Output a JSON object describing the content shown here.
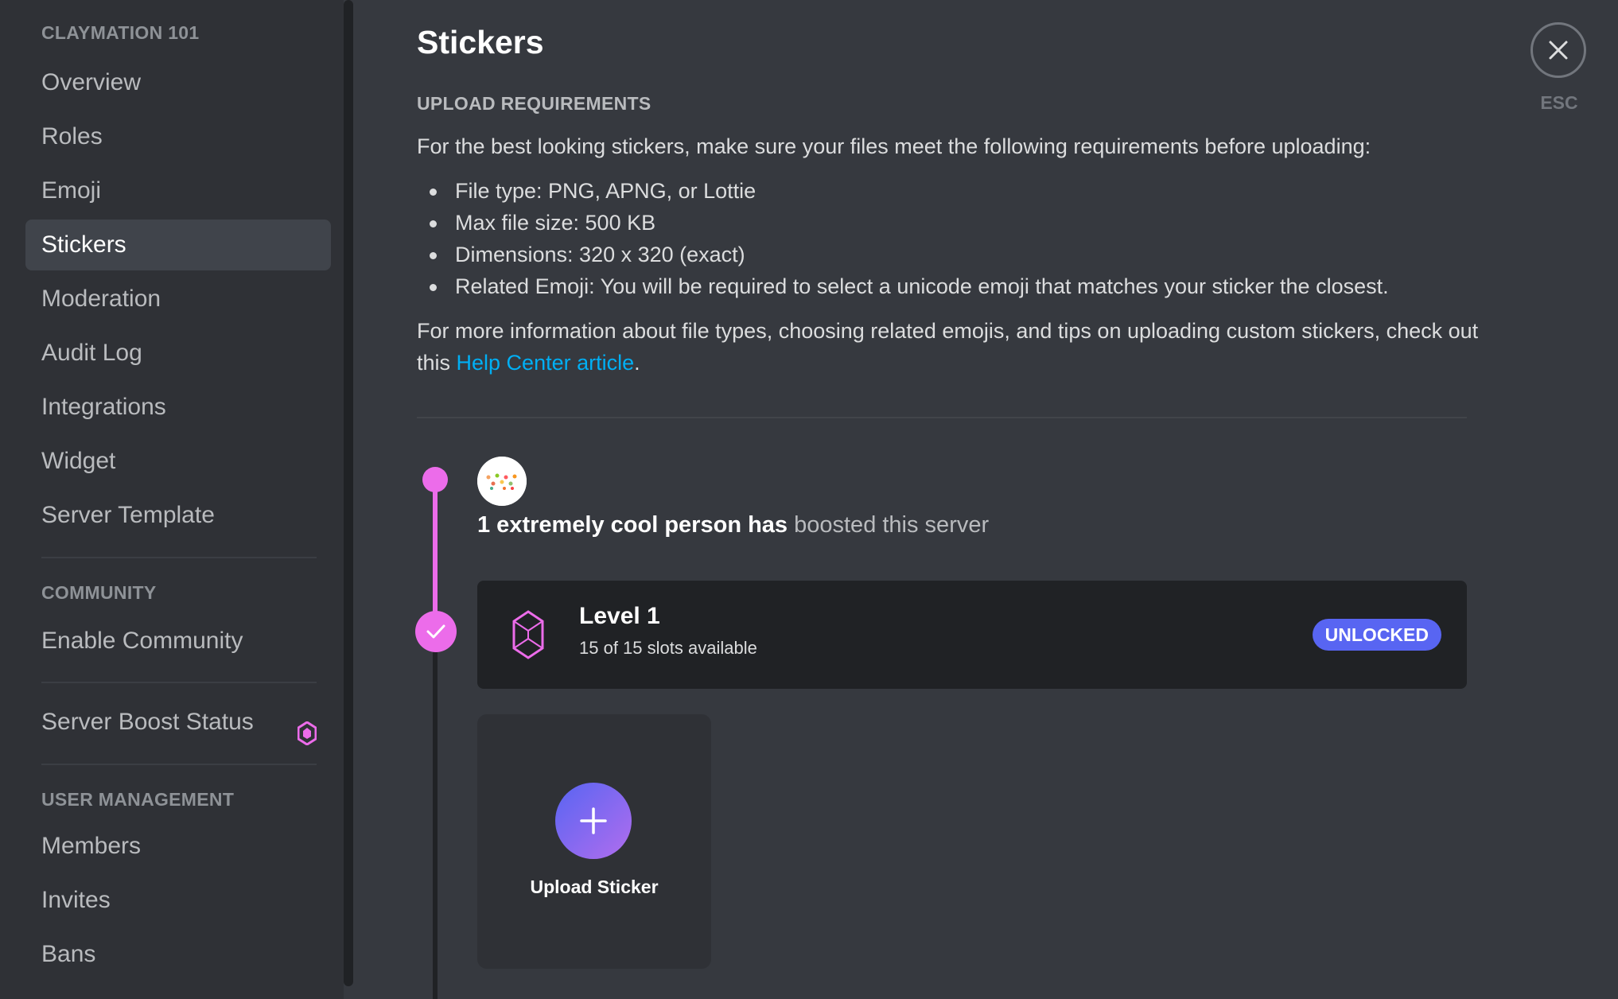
{
  "sidebar": {
    "server_header": "CLAYMATION 101",
    "items": [
      {
        "label": "Overview"
      },
      {
        "label": "Roles"
      },
      {
        "label": "Emoji"
      },
      {
        "label": "Stickers"
      },
      {
        "label": "Moderation"
      },
      {
        "label": "Audit Log"
      },
      {
        "label": "Integrations"
      },
      {
        "label": "Widget"
      },
      {
        "label": "Server Template"
      }
    ],
    "community_header": "COMMUNITY",
    "community_items": [
      {
        "label": "Enable Community"
      }
    ],
    "boost_item": {
      "label": "Server Boost Status"
    },
    "user_mgmt_header": "USER MANAGEMENT",
    "user_mgmt_items": [
      {
        "label": "Members"
      },
      {
        "label": "Invites"
      },
      {
        "label": "Bans"
      }
    ],
    "active_item": "Stickers"
  },
  "main": {
    "title": "Stickers",
    "requirements_header": "UPLOAD REQUIREMENTS",
    "intro": "For the best looking stickers, make sure your files meet the following requirements before uploading:",
    "requirements": [
      "File type: PNG, APNG, or Lottie",
      "Max file size: 500 KB",
      "Dimensions: 320 x 320 (exact)",
      "Related Emoji: You will be required to select a unicode emoji that matches your sticker the closest."
    ],
    "more_info_line1": "For more information about file types, choosing related emojis, and tips on uploading custom stickers, check out",
    "more_info_prefix": "this ",
    "help_link": "Help Center article",
    "more_info_suffix": ".",
    "boost_bold": "1 extremely cool person has",
    "boost_rest": " boosted this server",
    "level": {
      "title": "Level 1",
      "slots": "15 of 15 slots available",
      "status": "UNLOCKED"
    },
    "upload_label": "Upload Sticker",
    "esc_label": "ESC"
  },
  "colors": {
    "accent_pink": "#ec6cea",
    "blurple": "#5865f2",
    "link": "#00aff4"
  }
}
